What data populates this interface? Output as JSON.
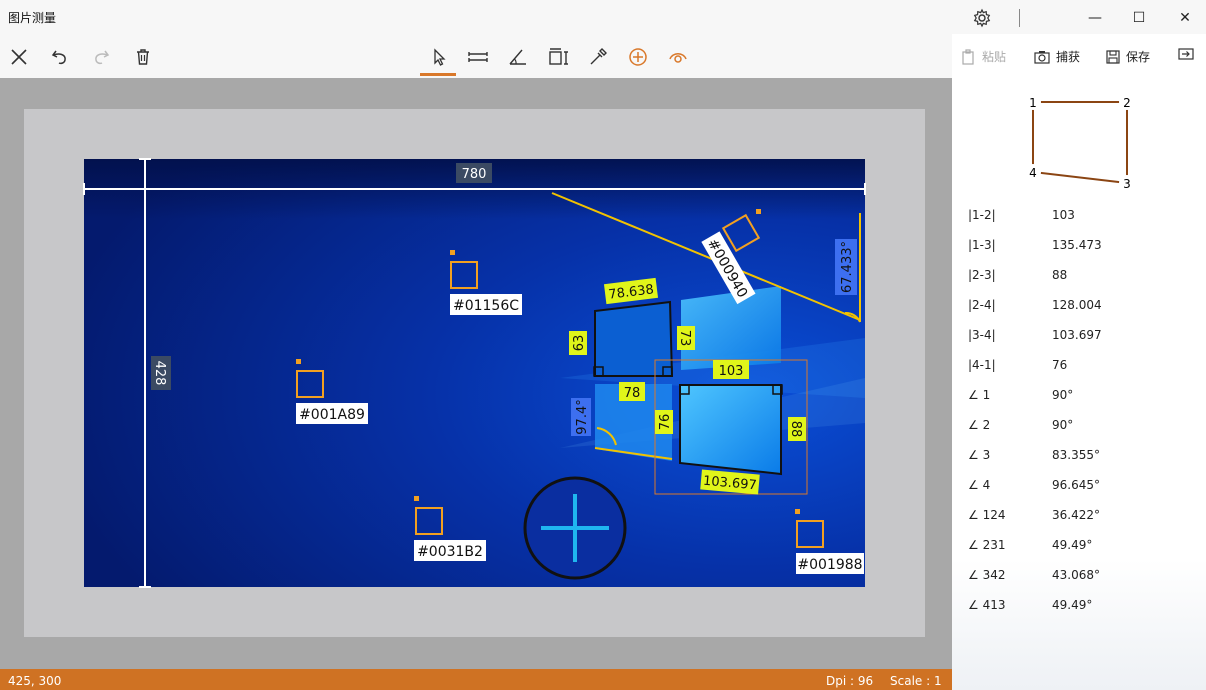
{
  "app": {
    "title": "图片测量"
  },
  "window": {
    "minimize": "—",
    "maximize": "☐",
    "close": "✕"
  },
  "toolbar": {
    "left": [
      "close-icon",
      "undo-icon",
      "redo-icon",
      "delete-icon"
    ],
    "center": [
      "pointer-icon",
      "ruler-icon",
      "angle-icon",
      "rect-measure-icon",
      "eyedropper-icon",
      "add-point-icon",
      "eye-icon"
    ],
    "selected": "pointer-icon"
  },
  "actions": {
    "paste": "粘贴",
    "capture": "捕获",
    "save": "保存"
  },
  "canvas": {
    "width_label": "780",
    "height_label": "428",
    "color_labels": [
      "#01156C",
      "#001A89",
      "#0031B2",
      "#001988",
      "#000940"
    ],
    "angle_labels": [
      "67.433°",
      "97.4°"
    ],
    "length_labels": [
      "78.638",
      "63",
      "73",
      "78",
      "76",
      "103",
      "88",
      "103.697"
    ]
  },
  "diagram": {
    "points": [
      "1",
      "2",
      "3",
      "4"
    ]
  },
  "measurements": [
    {
      "k": "|1-2|",
      "v": "103"
    },
    {
      "k": "|1-3|",
      "v": "135.473"
    },
    {
      "k": "|2-3|",
      "v": "88"
    },
    {
      "k": "|2-4|",
      "v": "128.004"
    },
    {
      "k": "|3-4|",
      "v": "103.697"
    },
    {
      "k": "|4-1|",
      "v": "76"
    },
    {
      "k": "∠ 1",
      "v": "90°"
    },
    {
      "k": "∠ 2",
      "v": "90°"
    },
    {
      "k": "∠ 3",
      "v": "83.355°"
    },
    {
      "k": "∠ 4",
      "v": "96.645°"
    },
    {
      "k": "∠ 124",
      "v": "36.422°"
    },
    {
      "k": "∠ 231",
      "v": "49.49°"
    },
    {
      "k": "∠ 342",
      "v": "43.068°"
    },
    {
      "k": "∠ 413",
      "v": "49.49°"
    }
  ],
  "status": {
    "coords": "425, 300",
    "dpi": "Dpi : 96",
    "scale": "Scale : 1"
  },
  "colors": {
    "accent": "#d9782a",
    "status_bar": "#cf7223",
    "highlight": "#e0f51a",
    "angle_box": "#3d6ff0"
  }
}
